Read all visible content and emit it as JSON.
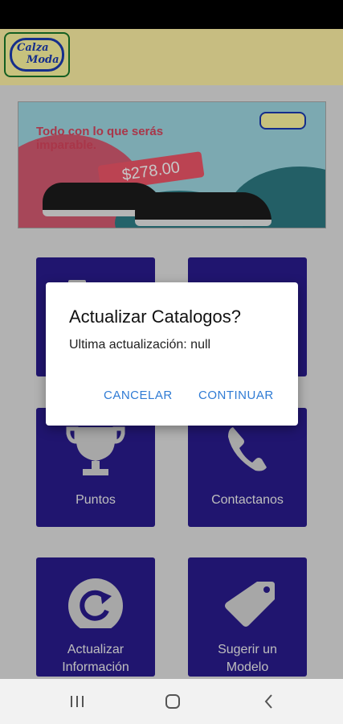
{
  "header": {
    "logo_line1": "Calza",
    "logo_line2": "Moda"
  },
  "banner": {
    "headline": "Todo con lo que serás imparable.",
    "price": "$278.00",
    "active_slide": 2,
    "slide_count": 2
  },
  "tiles": [
    {
      "label": "",
      "icon": "document-icon"
    },
    {
      "label": "",
      "icon": "cart-icon"
    },
    {
      "label": "Puntos",
      "icon": "trophy-icon"
    },
    {
      "label": "Contactanos",
      "icon": "phone-icon"
    },
    {
      "label": "Actualizar Información",
      "line1": "Actualizar",
      "line2": "Información",
      "icon": "refresh-icon"
    },
    {
      "label": "Sugerir un Modelo",
      "line1": "Sugerir un",
      "line2": "Modelo",
      "icon": "tag-icon"
    }
  ],
  "dialog": {
    "title": "Actualizar Catalogos?",
    "message": "Ultima actualización: null",
    "cancel_label": "CANCELAR",
    "continue_label": "CONTINUAR"
  },
  "nav": {
    "recents_icon": "recents-icon",
    "home_icon": "home-icon",
    "back_icon": "back-icon"
  },
  "colors": {
    "header_bg": "#fff3a6",
    "tile_bg": "#2a1b8f",
    "dialog_button": "#2f7bd4"
  }
}
